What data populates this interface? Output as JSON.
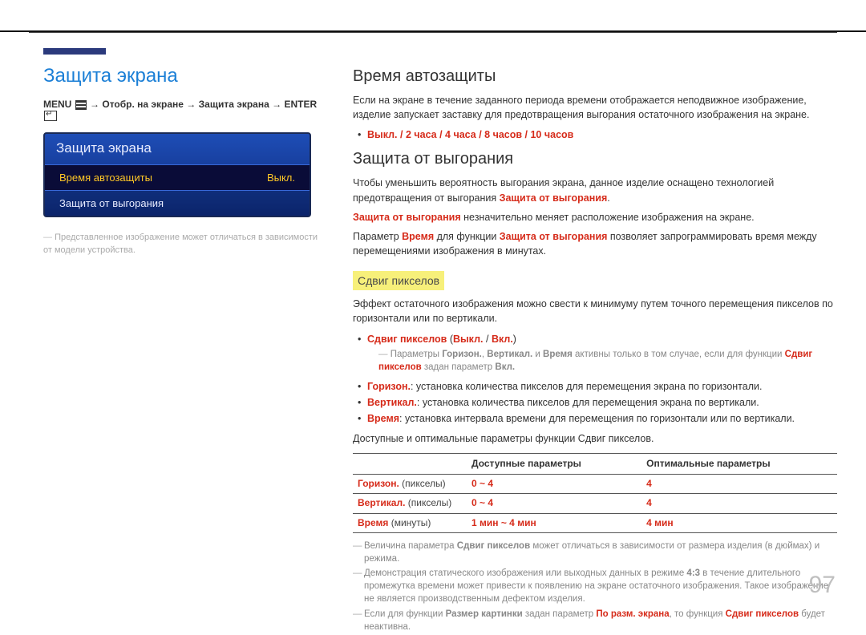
{
  "left": {
    "title": "Защита экрана",
    "menu_path_label": "MENU",
    "menu_path_parts": [
      "Отобр. на экране",
      "Защита экрана",
      "ENTER"
    ],
    "osd": {
      "header": "Защита экрана",
      "row1_label": "Время автозащиты",
      "row1_value": "Выкл.",
      "row2_label": "Защита от выгорания"
    },
    "disclaimer": "Представленное изображение может отличаться в зависимости от модели устройства."
  },
  "right": {
    "sec1_title": "Время автозащиты",
    "sec1_text": "Если на экране в течение заданного периода времени отображается неподвижное изображение, изделие запускает заставку для предотвращения выгорания остаточного изображения на экране.",
    "sec1_opts": "Выкл. / 2 часа / 4 часа / 8 часов / 10 часов",
    "sec2_title": "Защита от выгорания",
    "sec2_p1_a": "Чтобы уменьшить вероятность выгорания экрана, данное изделие оснащено технологией предотвращения от выгорания ",
    "sec2_p1_b": "Защита от выгорания",
    "sec2_p2_a": "Защита от выгорания",
    "sec2_p2_b": " незначительно меняет расположение изображения на экране.",
    "sec2_p3_a": "Параметр ",
    "sec2_p3_b": "Время",
    "sec2_p3_c": " для функции ",
    "sec2_p3_d": "Защита от выгорания",
    "sec2_p3_e": " позволяет запрограммировать время между перемещениями изображения в минутах.",
    "pixshift_h": "Сдвиг пикселов",
    "pixshift_p": "Эффект остаточного изображения можно свести к минимуму путем точного перемещения пикселов по горизонтали или по вертикали.",
    "pixshift_opt_line_a": "Сдвиг пикселов",
    "pixshift_opt_line_b": "Выкл.",
    "pixshift_opt_line_c": "Вкл.",
    "pixshift_sub_1a": "Параметры ",
    "pixshift_sub_1b": "Горизон.",
    "pixshift_sub_1c": "Вертикал.",
    "pixshift_sub_1d": "Время",
    "pixshift_sub_1e": " активны только в том случае, если для функции ",
    "pixshift_sub_1f": "Сдвиг пикселов",
    "pixshift_sub_1g": " задан параметр ",
    "pixshift_sub_1h": "Вкл.",
    "b_h_lbl": "Горизон.",
    "b_h_txt": ": установка количества пикселов для перемещения экрана по горизонтали.",
    "b_v_lbl": "Вертикал.",
    "b_v_txt": ": установка количества пикселов для перемещения экрана по вертикали.",
    "b_t_lbl": "Время",
    "b_t_txt": ": установка интервала времени для перемещения по горизонтали или по вертикали.",
    "tbl_caption": "Доступные и оптимальные параметры функции Сдвиг пикселов.",
    "tbl_h1": "",
    "tbl_h2": "Доступные параметры",
    "tbl_h3": "Оптимальные параметры",
    "tbl_r1_lbl": "Горизон.",
    "tbl_r1_unit": "(пикселы)",
    "tbl_r1_avail": "0 ~ 4",
    "tbl_r1_opt": "4",
    "tbl_r2_lbl": "Вертикал.",
    "tbl_r2_unit": "(пикселы)",
    "tbl_r2_avail": "0 ~ 4",
    "tbl_r2_opt": "4",
    "tbl_r3_lbl": "Время",
    "tbl_r3_unit": "(минуты)",
    "tbl_r3_avail": "1 мин ~ 4 мин",
    "tbl_r3_opt": "4 мин",
    "fn1_a": "Величина параметра ",
    "fn1_b": "Сдвиг пикселов",
    "fn1_c": " может отличаться в зависимости от размера изделия (в дюймах) и режима.",
    "fn2_a": "Демонстрация статического изображения или выходных данных в режиме ",
    "fn2_b": "4:3",
    "fn2_c": " в течение длительного промежутка времени может привести к появлению на экране остаточного изображения. Такое изображение не является производственным дефектом изделия.",
    "fn3_a": "Если для функции ",
    "fn3_b": "Размер картинки",
    "fn3_c": " задан параметр ",
    "fn3_d": "По разм. экрана",
    "fn3_e": ", то функция ",
    "fn3_f": "Сдвиг пикселов",
    "fn3_g": " будет неактивна."
  },
  "page_number": "97"
}
